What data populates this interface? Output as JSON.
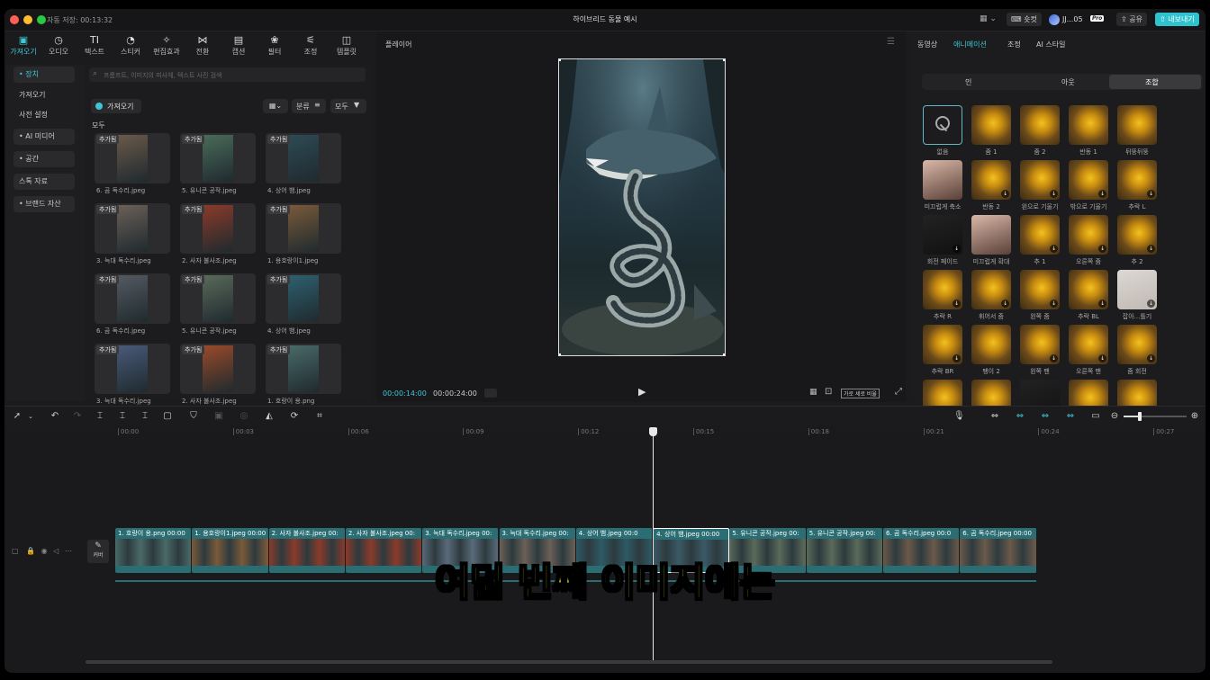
{
  "titlebar": {
    "autosave": "자동 저장: 00:13:32",
    "project_title": "하이브리드 동물 예시",
    "shortcut_label": "숏컷",
    "user_label": "JJ...05",
    "pro_badge": "Pro",
    "share_label": "공유",
    "export_label": "내보내기"
  },
  "tools": [
    {
      "label": "가져오기",
      "icon": "import-icon"
    },
    {
      "label": "오디오",
      "icon": "audio-icon"
    },
    {
      "label": "텍스트",
      "icon": "text-icon"
    },
    {
      "label": "스티커",
      "icon": "sticker-icon"
    },
    {
      "label": "편집효과",
      "icon": "effects-icon"
    },
    {
      "label": "전환",
      "icon": "transition-icon"
    },
    {
      "label": "캡션",
      "icon": "caption-icon"
    },
    {
      "label": "필터",
      "icon": "filter-icon"
    },
    {
      "label": "조정",
      "icon": "adjust-icon"
    },
    {
      "label": "템플릿",
      "icon": "template-icon"
    }
  ],
  "sidebar": {
    "device": "• 장치",
    "import": "가져오기",
    "preset": "사전 설정",
    "ai_media": "• AI 미디어",
    "space": "• 공간",
    "stock": "스톡 자료",
    "brand": "• 브랜드 자산"
  },
  "media": {
    "search_placeholder": "프롬프트, 이미지의 피사체, 텍스트 사진 검색",
    "import_button": "가져오기",
    "sort_label": "분류",
    "all_label": "모두",
    "section_all": "모두",
    "badge": "추가됨",
    "items": [
      "6. 곰 독수리.jpeg",
      "5. 유니콘 공작.jpeg",
      "4. 상어 뱀.jpeg",
      "3. 늑대 독수리.jpeg",
      "2. 사자 불사조.jpeg",
      "1. 용호랑이1.jpeg",
      "6. 곰 독수리.jpeg",
      "5. 유니콘 공작.jpeg",
      "4. 상어 뱀.jpeg",
      "3. 늑대 독수리.jpeg",
      "2. 사자 불사조.jpeg",
      "1. 호랑이 용.png"
    ],
    "item_colors": [
      "#6b5a4a",
      "#4a6b5a",
      "#2e4a55",
      "#6b6058",
      "#8b3a2a",
      "#7a5a3a",
      "#555a62",
      "#5a6a5a",
      "#2e6070",
      "#4a5a7a",
      "#9a4a2a",
      "#4a6a6a"
    ]
  },
  "player": {
    "title": "플레이어",
    "current_time": "00:00:14:00",
    "total_time": "00:00:24:00",
    "ratio_label": "가로 세로 비율"
  },
  "right_panel": {
    "tabs": [
      "동영상",
      "애니메이션",
      "조정",
      "AI 스타일"
    ],
    "active_tab": 1,
    "subtabs": [
      "인",
      "아웃",
      "조합"
    ],
    "active_subtab": 2,
    "animations": [
      "없음",
      "줌 1",
      "줌 2",
      "반동 1",
      "뒤뚱뒤뚱",
      "미끄럽게 축소",
      "반동 2",
      "왼으로 기울기",
      "밖으로 기울기",
      "추락 L",
      "회전 페이드",
      "미끄럽게 확대",
      "추 1",
      "오른쪽 줌",
      "추 2",
      "추락 R",
      "휘어서 줌",
      "왼쪽 줌",
      "추락 BL",
      "잡아...틀기",
      "추락 BR",
      "팽이 2",
      "왼쪽 팬",
      "오른쪽 팬",
      "줌 회전",
      "",
      "",
      "",
      "",
      ""
    ]
  },
  "timeline": {
    "ticks": [
      "00:00",
      "00:03",
      "00:06",
      "00:09",
      "00:12",
      "00:15",
      "00:18",
      "00:21",
      "00:24",
      "00:27"
    ],
    "cover_label": "커버",
    "clips": [
      "1. 호랑이 용.png 00:00",
      "1. 용호랑이1.jpeg 00:00",
      "2. 사자 불사조.jpeg 00:",
      "2. 사자 불사조.jpeg 00:",
      "3. 늑대 독수리.jpeg 00:",
      "3. 늑대 독수리.jpeg 00:",
      "4. 상어 뱀.jpeg 00:0",
      "4. 상어 뱀.jpeg 00:00",
      "5. 유니콘 공작.jpeg 00:",
      "5. 유니콘 공작.jpeg 00:",
      "6. 곰 독수리.jpeg 00:0",
      "6. 곰 독수리.jpeg 00:00"
    ],
    "clip_colors": [
      "#4a6a66",
      "#7a5a3a",
      "#8b3a2a",
      "#8b3a2a",
      "#5a6a7a",
      "#6b6058",
      "#2e5a66",
      "#3a5a66",
      "#5a6a5a",
      "#5a6a5a",
      "#6b5a4a",
      "#6b5a4a"
    ]
  },
  "subtitle": "여덟 번째 이미지에는"
}
